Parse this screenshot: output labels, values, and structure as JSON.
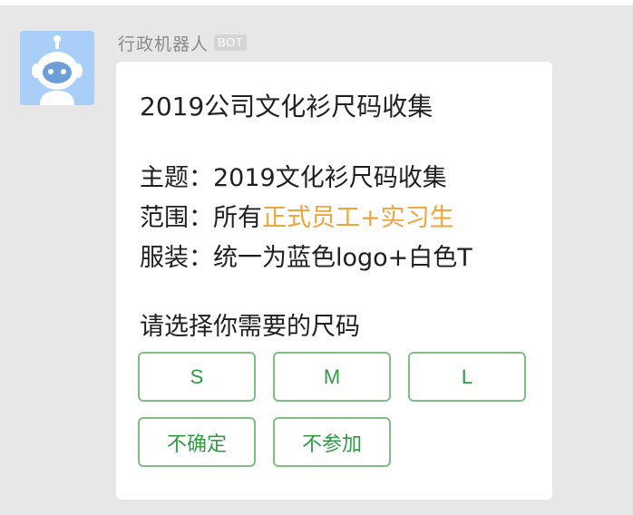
{
  "sender": {
    "name": "行政机器人",
    "badge": "BOT"
  },
  "card": {
    "title": "2019公司文化衫尺码收集",
    "lines": [
      {
        "label": "主题：",
        "value": "2019文化衫尺码收集",
        "highlight": ""
      },
      {
        "label": "范围：",
        "value": "所有",
        "highlight": "正式员工+实习生"
      },
      {
        "label": "服装：",
        "value": "统一为蓝色logo+白色T",
        "highlight": ""
      }
    ],
    "prompt": "请选择你需要的尺码",
    "options": [
      "S",
      "M",
      "L",
      "不确定",
      "不参加"
    ]
  },
  "colors": {
    "background": "#e7e7e7",
    "avatar_bg": "#a9cff9",
    "highlight": "#f0a43b",
    "button_border": "#7fbf86",
    "button_text": "#2f9b43"
  },
  "icons": {
    "avatar": "robot-avatar-icon"
  }
}
